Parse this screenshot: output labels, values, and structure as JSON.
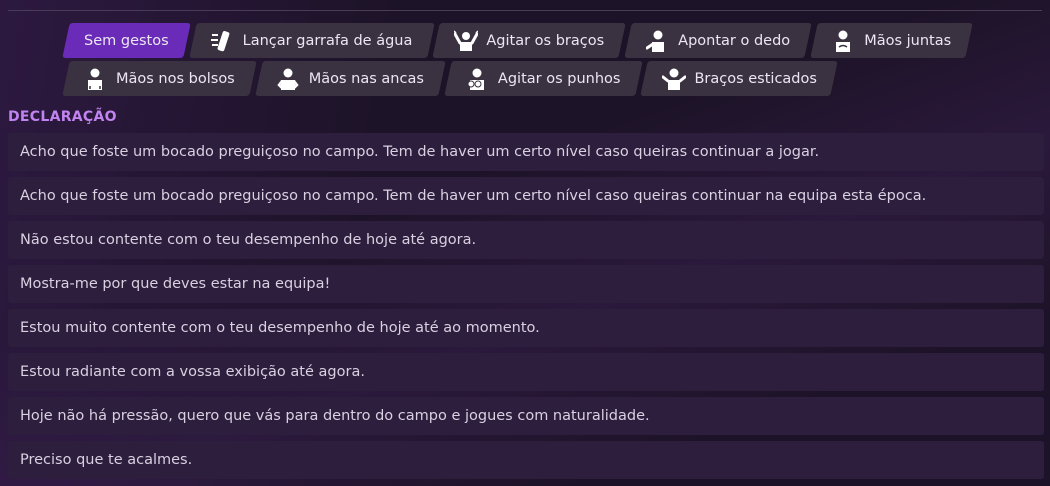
{
  "gestures": {
    "row1": [
      {
        "label": "Sem gestos",
        "icon": "none",
        "active": true
      },
      {
        "label": "Lançar garrafa de água",
        "icon": "water-bottle-icon",
        "active": false
      },
      {
        "label": "Agitar os braços",
        "icon": "wave-arms-icon",
        "active": false
      },
      {
        "label": "Apontar o dedo",
        "icon": "point-finger-icon",
        "active": false
      },
      {
        "label": "Mãos juntas",
        "icon": "hands-together-icon",
        "active": false
      }
    ],
    "row2": [
      {
        "label": "Mãos nos bolsos",
        "icon": "hands-pockets-icon",
        "active": false
      },
      {
        "label": "Mãos nas ancas",
        "icon": "hands-hips-icon",
        "active": false
      },
      {
        "label": "Agitar os punhos",
        "icon": "shake-fists-icon",
        "active": false
      },
      {
        "label": "Braços esticados",
        "icon": "arms-outstretched-icon",
        "active": false
      }
    ]
  },
  "section_label": "DECLARAÇÃO",
  "statements": [
    "Acho que foste um bocado preguiçoso no campo. Tem de haver um certo nível caso queiras continuar a jogar.",
    "Acho que foste um bocado preguiçoso no campo. Tem de haver um certo nível caso queiras continuar na equipa esta época.",
    "Não estou contente com o teu desempenho de hoje até agora.",
    "Mostra-me por que deves estar na equipa!",
    "Estou muito contente com o teu desempenho de hoje até ao momento.",
    "Estou radiante com a vossa exibição até agora.",
    "Hoje não há pressão, quero que vás para dentro do campo e jogues com naturalidade.",
    "Preciso que te acalmes."
  ],
  "colors": {
    "accent": "#6a2bb8",
    "chip": "#3a3240",
    "section_label": "#c083f0",
    "statement_bg": "#2c1e3c"
  }
}
